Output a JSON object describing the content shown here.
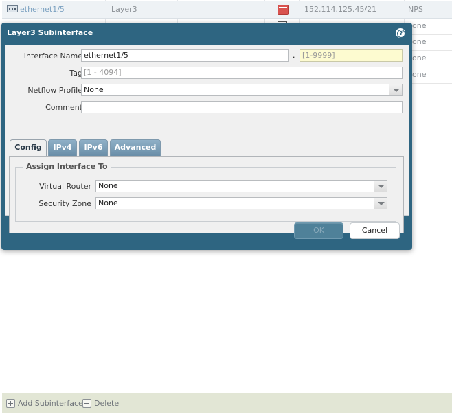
{
  "background_table": {
    "first_row": {
      "name": "ethernet1/5",
      "type": "Layer3",
      "ip": "152.114.125.45/21",
      "zone": "NPS"
    },
    "partial_rows": [
      "one",
      "one",
      "one",
      "one"
    ]
  },
  "bottom_bar": {
    "add_label": "Add Subinterface",
    "delete_label": "Delete"
  },
  "dialog": {
    "title": "Layer3 Subinterface",
    "help_glyph": "?",
    "fields": {
      "interface_name_label": "Interface Name",
      "interface_name_value": "ethernet1/5",
      "separator": ".",
      "sub_id_placeholder": "[1-9999]",
      "tag_label": "Tag",
      "tag_placeholder": "[1 - 4094]",
      "netflow_label": "Netflow Profile",
      "netflow_value": "None",
      "comment_label": "Comment",
      "comment_value": ""
    },
    "tabs": [
      "Config",
      "IPv4",
      "IPv6",
      "Advanced"
    ],
    "active_tab": "Config",
    "config": {
      "legend": "Assign Interface To",
      "virtual_router_label": "Virtual Router",
      "virtual_router_value": "None",
      "security_zone_label": "Security Zone",
      "security_zone_value": "None"
    },
    "buttons": {
      "ok": "OK",
      "cancel": "Cancel"
    }
  },
  "colors": {
    "dialog_header": "#2e6581",
    "tab_inactive": "#7a9db6",
    "bottom_bar": "#e2e6d5"
  }
}
